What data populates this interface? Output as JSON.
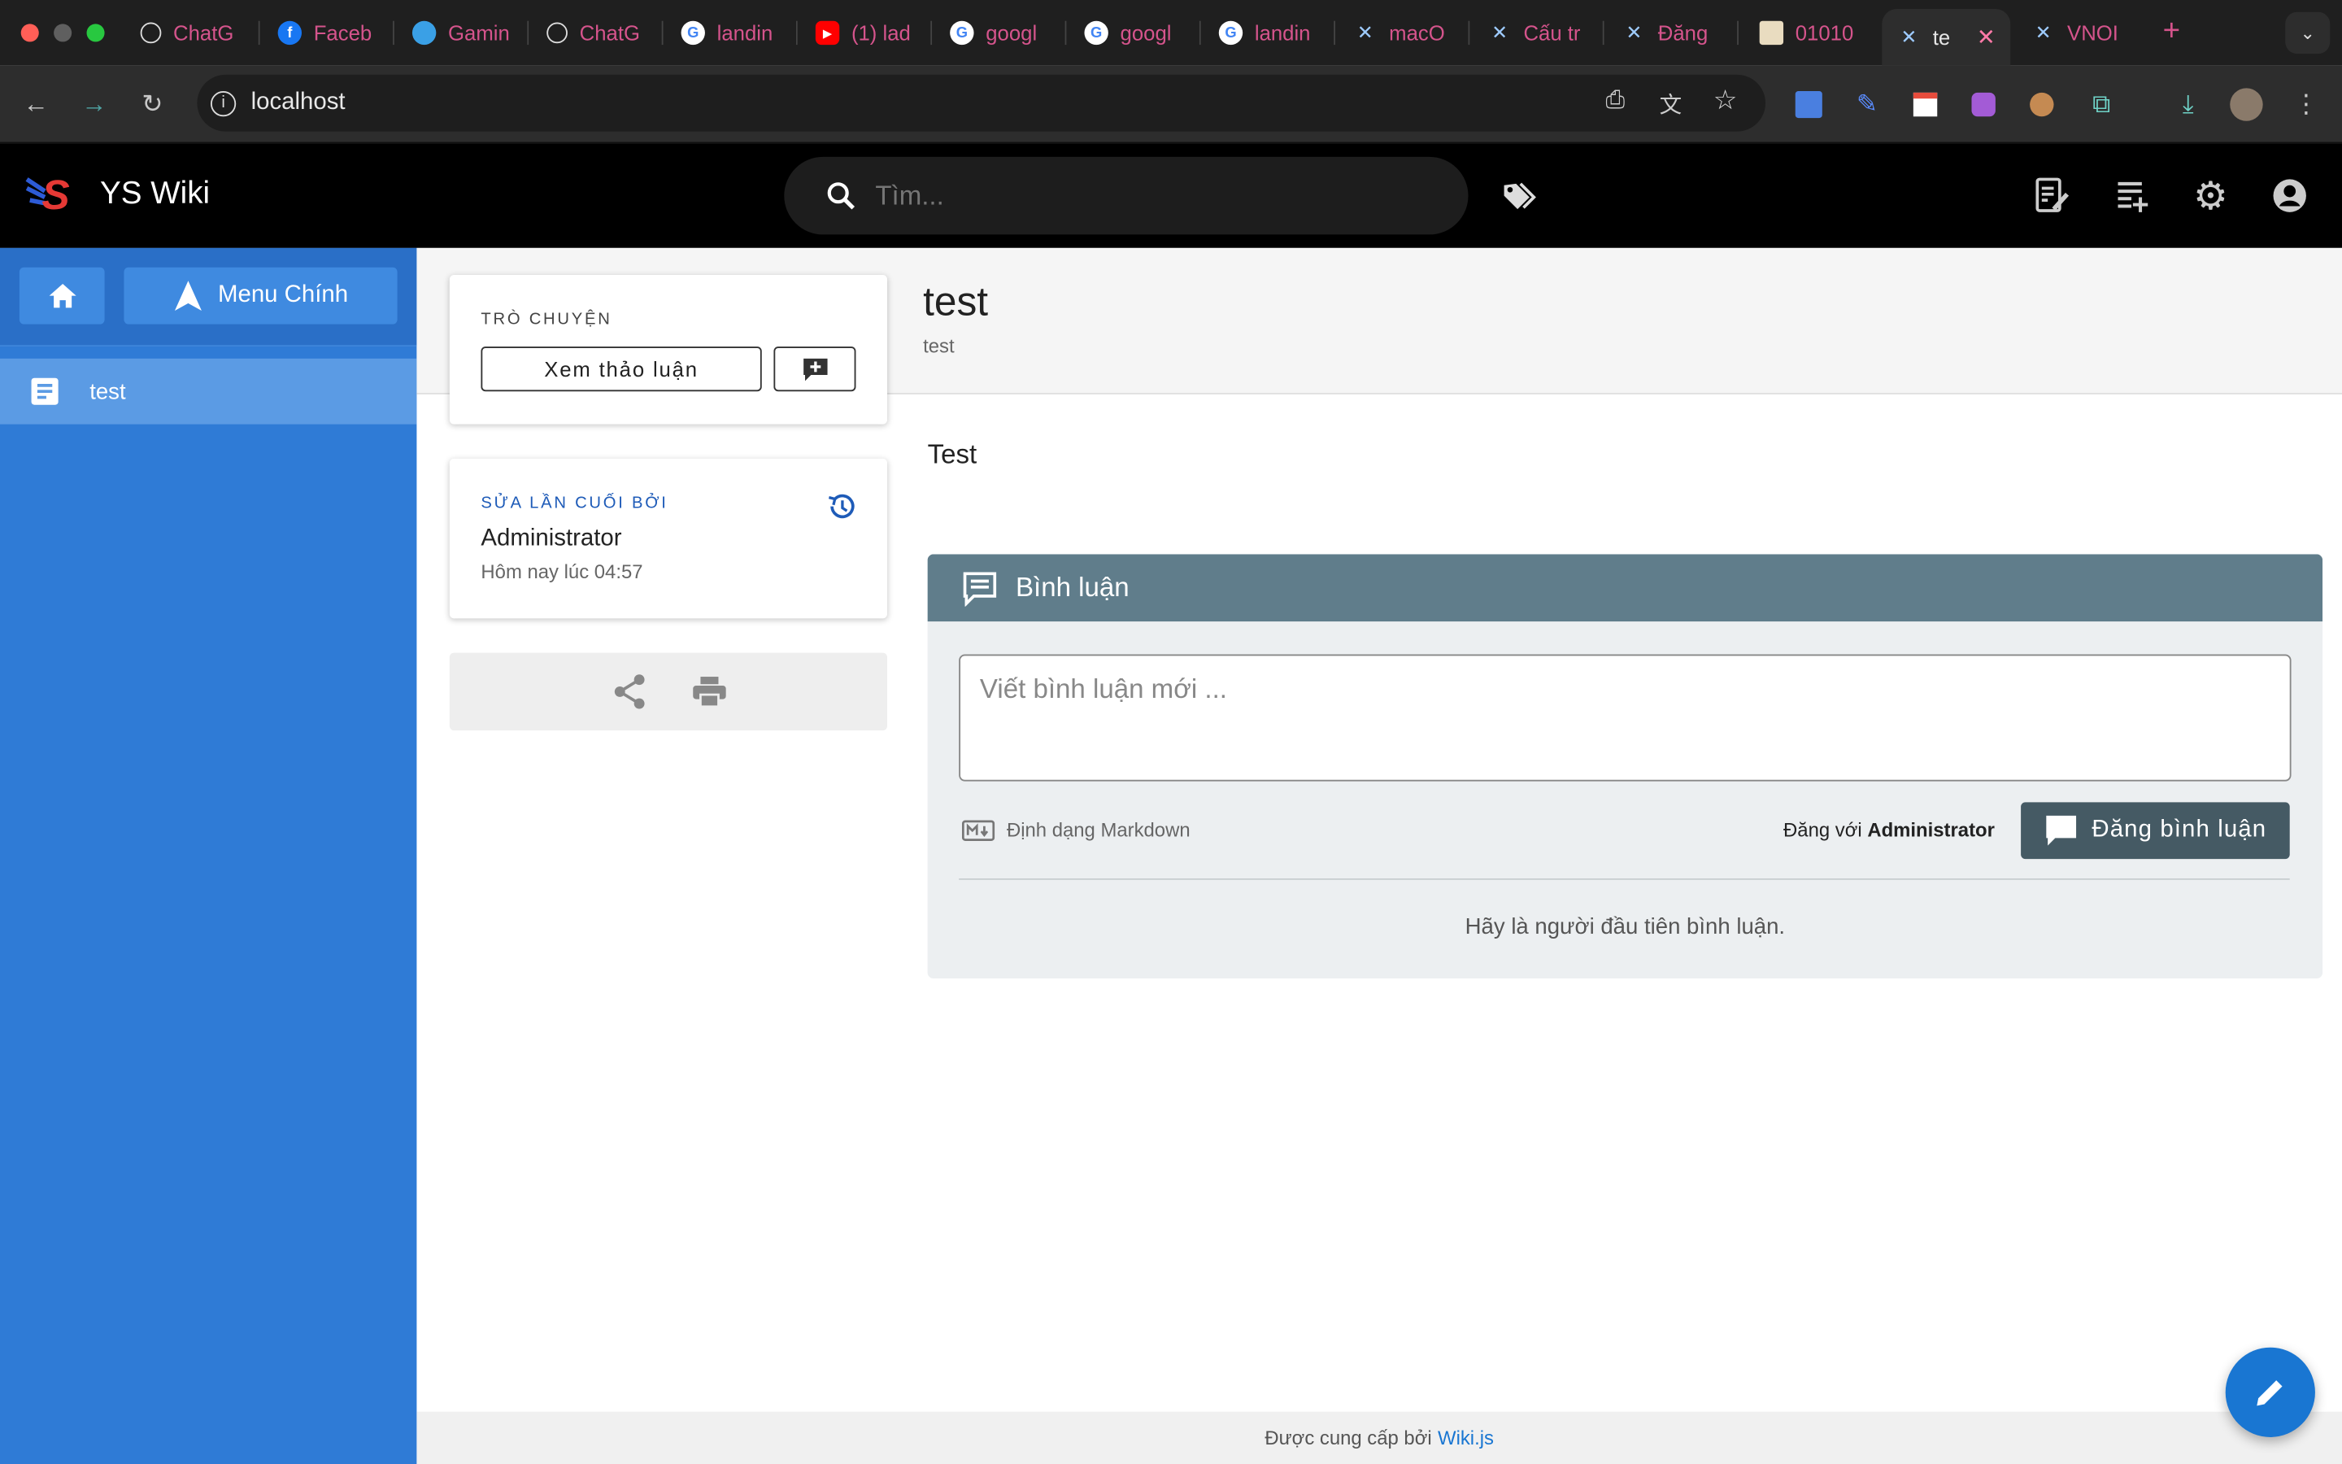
{
  "browser": {
    "tabs": [
      {
        "label": "ChatG",
        "icon": "openai-icon"
      },
      {
        "label": "Faceb",
        "icon": "facebook-icon"
      },
      {
        "label": "Gamin",
        "icon": "globe-icon"
      },
      {
        "label": "ChatG",
        "icon": "openai-icon"
      },
      {
        "label": "landin",
        "icon": "google-icon"
      },
      {
        "label": "(1) lad",
        "icon": "youtube-icon"
      },
      {
        "label": "googl",
        "icon": "google-icon"
      },
      {
        "label": "googl",
        "icon": "google-icon"
      },
      {
        "label": "landin",
        "icon": "google-icon"
      },
      {
        "label": "macO",
        "icon": "wiki-icon"
      },
      {
        "label": "Cấu tr",
        "icon": "wiki-icon"
      },
      {
        "label": "Đăng",
        "icon": "wiki-icon"
      },
      {
        "label": "01010",
        "icon": "document-icon"
      },
      {
        "label": "te",
        "icon": "wiki-icon"
      },
      {
        "label": "VNOI",
        "icon": "wiki-icon"
      }
    ],
    "url": "localhost"
  },
  "header": {
    "brand": "YS Wiki",
    "search_placeholder": "Tìm..."
  },
  "sidebar": {
    "menu_label": "Menu Chính",
    "items": [
      {
        "label": "test"
      }
    ]
  },
  "page": {
    "title": "test",
    "description": "test",
    "content": "Test"
  },
  "discussion_card": {
    "caption": "TRÒ CHUYỆN",
    "view_button": "Xem thảo luận"
  },
  "last_edit_card": {
    "caption": "SỬA LẦN CUỐI BỞI",
    "author": "Administrator",
    "time": "Hôm nay lúc 04:57"
  },
  "comments": {
    "title": "Bình luận",
    "placeholder": "Viết bình luận mới ...",
    "markdown_label": "Định dạng Markdown",
    "post_as_prefix": "Đăng với",
    "post_as_user": "Administrator",
    "post_button": "Đăng bình luận",
    "empty_message": "Hãy là người đầu tiên bình luận."
  },
  "footer": {
    "prefix": "Được cung cấp bởi",
    "link": "Wiki.js"
  },
  "colors": {
    "sidebar": "#2f7bd6",
    "header": "#000000",
    "comments_header": "#607d8b",
    "post_button": "#455a64",
    "fab": "#1976d2"
  }
}
